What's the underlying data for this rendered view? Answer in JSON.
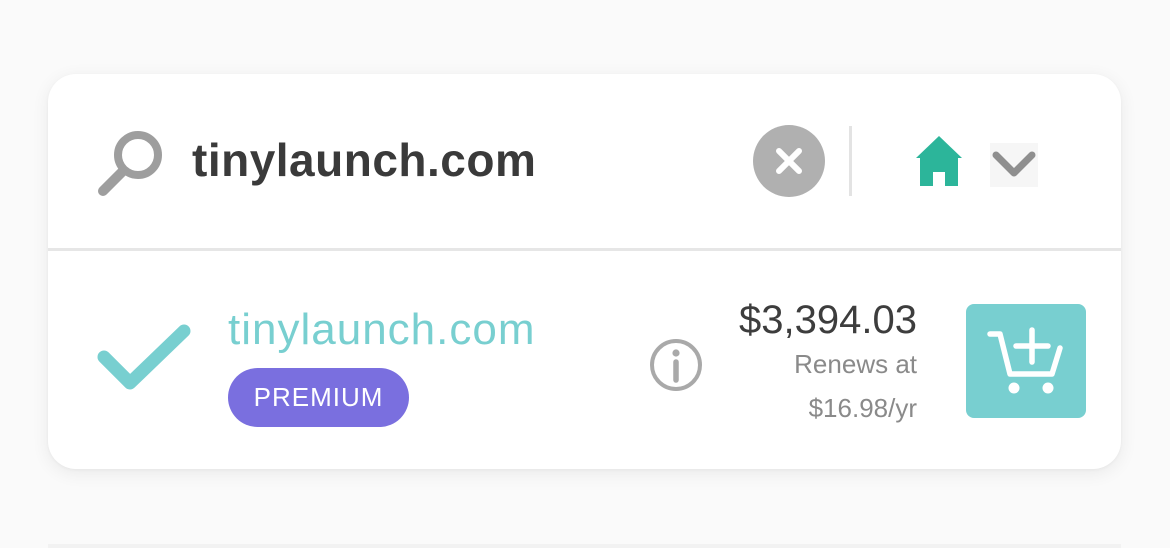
{
  "search": {
    "query": "tinylaunch.com",
    "icons": {
      "search": "search-icon",
      "clear": "close-circle-icon",
      "tld": "house-icon",
      "dropdown": "chevron-down-icon"
    }
  },
  "result": {
    "domain": "tinylaunch.com",
    "badge": "PREMIUM",
    "price": "$3,394.03",
    "renew_label": "Renews at",
    "renew_price": "$16.98/yr",
    "icons": {
      "status": "checkmark-icon",
      "info": "info-icon",
      "add_to_cart": "cart-plus-icon"
    }
  },
  "colors": {
    "accent_teal": "#78cfd0",
    "house_green": "#2cb59a",
    "premium_purple": "#7a6fdf",
    "clear_gray": "#b0b0b0",
    "text_dark": "#3a3a3a",
    "text_muted": "#8a8a8a"
  }
}
